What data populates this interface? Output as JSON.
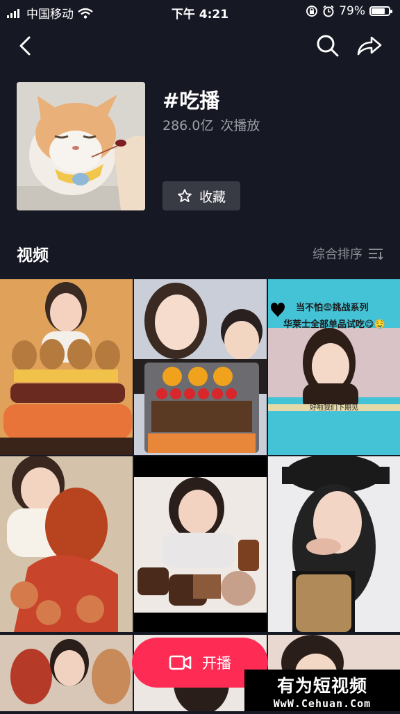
{
  "status_bar": {
    "carrier": "中国移动",
    "time": "下午 4:21",
    "battery": "79%",
    "battery_level": 0.79
  },
  "nav": {
    "back_icon": "back-arrow-icon",
    "search_icon": "search-icon",
    "share_icon": "share-icon"
  },
  "hashtag": {
    "title": "#吃播",
    "play_count": "286.0亿",
    "play_suffix": "次播放",
    "favorite_label": "收藏"
  },
  "videos_section": {
    "title": "视频",
    "sort_label": "综合排序"
  },
  "videos": [
    {
      "overlay_lines": []
    },
    {
      "overlay_lines": []
    },
    {
      "overlay_lines": [
        "当不怕😨挑战系列",
        "华莱士全部单品试吃😋🤤",
        "好啦我们下期见"
      ]
    },
    {
      "overlay_lines": []
    },
    {
      "overlay_lines": []
    },
    {
      "overlay_lines": []
    }
  ],
  "live_button": {
    "label": "开播"
  },
  "watermark": {
    "title": "有为短视频",
    "url": "WwW.Cehuan.Com"
  },
  "colors": {
    "background": "#161823",
    "accent": "#fe2c55",
    "button_bg": "#393b44"
  }
}
